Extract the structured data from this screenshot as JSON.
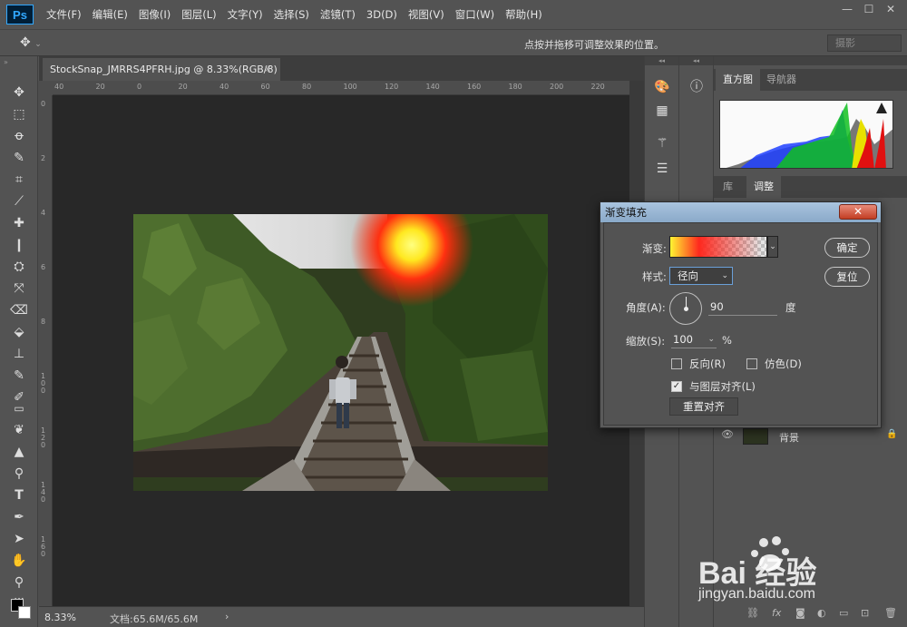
{
  "app": {
    "logo": "Ps"
  },
  "menu": [
    "文件(F)",
    "编辑(E)",
    "图像(I)",
    "图层(L)",
    "文字(Y)",
    "选择(S)",
    "滤镜(T)",
    "3D(D)",
    "视图(V)",
    "窗口(W)",
    "帮助(H)"
  ],
  "options_bar": {
    "hint": "点按并拖移可调整效果的位置。",
    "workspace": "摄影"
  },
  "document": {
    "tab_title": "StockSnap_JMRRS4PFRH.jpg @ 8.33%(RGB/8)",
    "close": "×"
  },
  "ruler_h": [
    "40",
    "20",
    "0",
    "20",
    "40",
    "60",
    "80",
    "100",
    "120",
    "140",
    "160",
    "180",
    "200",
    "220",
    "240"
  ],
  "ruler_v": [
    "0",
    "2",
    "4",
    "6",
    "8",
    "1 0 0",
    "1 2 0",
    "1 4 0",
    "1 6 0"
  ],
  "status": {
    "zoom": "8.33%",
    "doc_info": "文档:65.6M/65.6M"
  },
  "panels": {
    "top_tabs": [
      "直方图",
      "导航器"
    ],
    "mid_tabs": [
      "库",
      "调整"
    ],
    "layer_name": "背景"
  },
  "dialog": {
    "title": "渐变填充",
    "gradient_label": "渐变:",
    "style_label": "样式:",
    "style_value": "径向",
    "angle_label": "角度(A):",
    "angle_value": "90",
    "angle_unit": "度",
    "scale_label": "缩放(S):",
    "scale_value": "100",
    "scale_unit": "%",
    "reverse_label": "反向(R)",
    "reverse_checked": false,
    "dither_label": "仿色(D)",
    "dither_checked": false,
    "align_label": "与图层对齐(L)",
    "align_checked": true,
    "reset_align_label": "重置对齐",
    "ok_label": "确定",
    "reset_label": "复位"
  },
  "watermark": {
    "brand": "Bai 经验",
    "url": "jingyan.baidu.com"
  }
}
